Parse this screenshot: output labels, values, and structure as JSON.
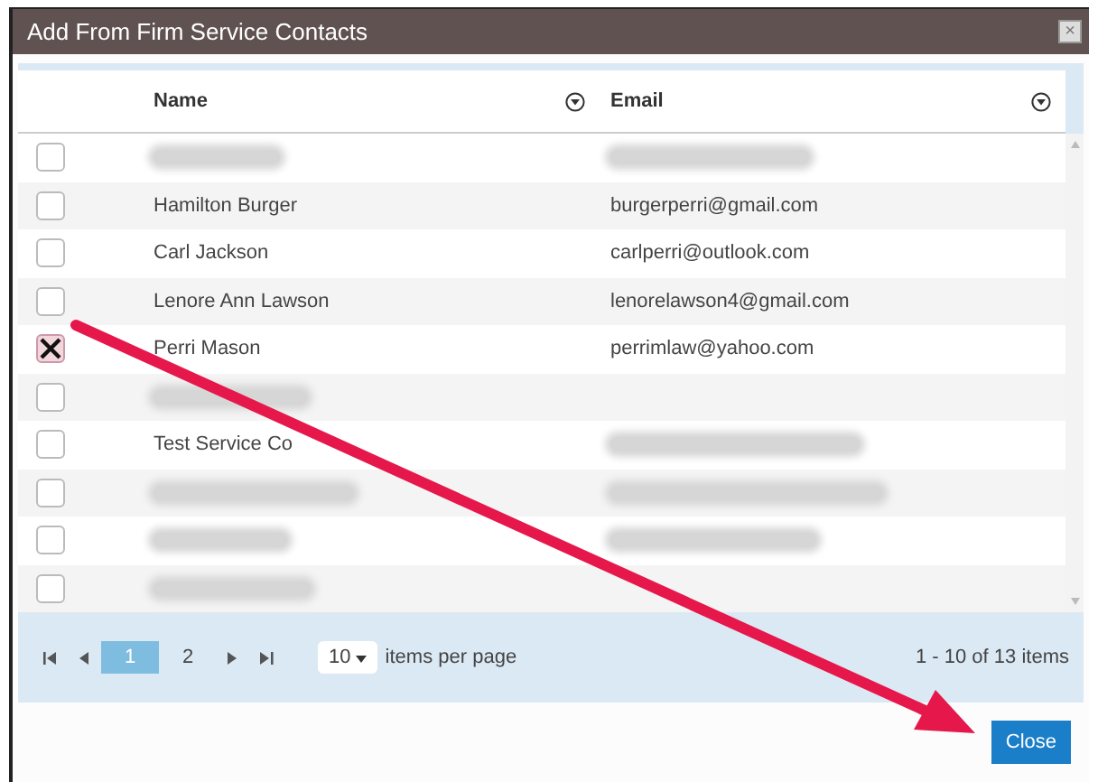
{
  "window": {
    "title": "Add From Firm Service Contacts",
    "close": "×"
  },
  "table": {
    "columns": [
      {
        "label": "Name"
      },
      {
        "label": "Email"
      }
    ],
    "rows": [
      {
        "checked": false,
        "name_blurred": true,
        "email_blurred": true
      },
      {
        "checked": false,
        "name": "Hamilton Burger",
        "email": "burgerperri@gmail.com"
      },
      {
        "checked": false,
        "name": "Carl Jackson",
        "email": "carlperri@outlook.com"
      },
      {
        "checked": false,
        "name": "Lenore Ann Lawson",
        "email": "lenorelawson4@gmail.com"
      },
      {
        "checked": true,
        "name": "Perri Mason",
        "email": "perrimlaw@yahoo.com"
      },
      {
        "checked": false,
        "name_blurred": true
      },
      {
        "checked": false,
        "name": "Test Service Co",
        "email_blurred": true
      },
      {
        "checked": false,
        "name_blurred": true,
        "email_blurred": true
      },
      {
        "checked": false,
        "name_blurred": true,
        "email_blurred": true
      },
      {
        "checked": false,
        "name_blurred": true
      }
    ]
  },
  "pager": {
    "pages": [
      {
        "label": "1",
        "selected": true
      },
      {
        "label": "2",
        "selected": false
      }
    ],
    "page_size": "10",
    "page_size_label": "items per page",
    "summary": "1 - 10 of 13 items"
  },
  "buttons": [
    "Close"
  ]
}
